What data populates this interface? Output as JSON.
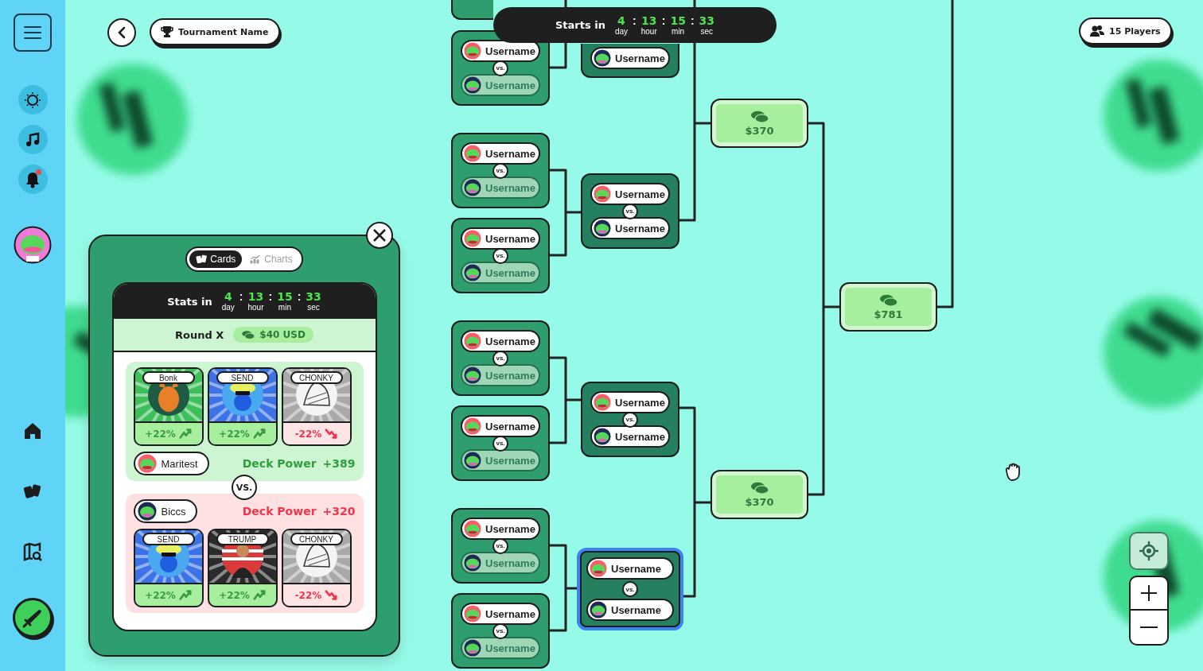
{
  "header": {
    "title": "Tournament Name",
    "players": "15 Players"
  },
  "countdown": {
    "label": "Starts in",
    "separator": ":",
    "units": [
      {
        "value": "4",
        "unit": "day"
      },
      {
        "value": "13",
        "unit": "hour"
      },
      {
        "value": "15",
        "unit": "min"
      },
      {
        "value": "33",
        "unit": "sec"
      }
    ]
  },
  "bracket": {
    "round_1": [
      {
        "selected": false,
        "vs": "vs.",
        "players": [
          {
            "name": "Username",
            "eliminated": false
          },
          {
            "name": "Username",
            "eliminated": true
          }
        ]
      },
      {
        "selected": false,
        "vs": "vs.",
        "players": [
          {
            "name": "Username",
            "eliminated": false
          },
          {
            "name": "Username",
            "eliminated": true
          }
        ]
      },
      {
        "selected": false,
        "vs": "vs.",
        "players": [
          {
            "name": "Username",
            "eliminated": false
          },
          {
            "name": "Username",
            "eliminated": true
          }
        ]
      },
      {
        "selected": false,
        "vs": "vs.",
        "players": [
          {
            "name": "Username",
            "eliminated": false
          },
          {
            "name": "Username",
            "eliminated": true
          }
        ]
      },
      {
        "selected": false,
        "vs": "vs.",
        "players": [
          {
            "name": "Username",
            "eliminated": false
          },
          {
            "name": "Username",
            "eliminated": true
          }
        ]
      },
      {
        "selected": false,
        "vs": "vs.",
        "players": [
          {
            "name": "Username",
            "eliminated": false
          },
          {
            "name": "Username",
            "eliminated": true
          }
        ]
      },
      {
        "selected": false,
        "vs": "vs.",
        "players": [
          {
            "name": "Username",
            "eliminated": false
          },
          {
            "name": "Username",
            "eliminated": true
          }
        ]
      }
    ],
    "round_2": [
      {
        "selected": false,
        "players": [
          {
            "name": "Username",
            "eliminated": false
          }
        ]
      },
      {
        "selected": false,
        "vs": "vs.",
        "players": [
          {
            "name": "Username",
            "eliminated": false
          },
          {
            "name": "Username",
            "eliminated": false
          }
        ]
      },
      {
        "selected": false,
        "vs": "vs.",
        "players": [
          {
            "name": "Username",
            "eliminated": false
          },
          {
            "name": "Username",
            "eliminated": false
          }
        ]
      },
      {
        "selected": true,
        "vs": "vs.",
        "players": [
          {
            "name": "Username",
            "eliminated": false
          },
          {
            "name": "Username",
            "eliminated": false
          }
        ]
      }
    ],
    "prizes": [
      {
        "amount": "$370"
      },
      {
        "amount": "$370"
      },
      {
        "amount": "$781"
      }
    ]
  },
  "match_panel": {
    "tabs": [
      {
        "label": "Cards",
        "selected": true
      },
      {
        "label": "Charts",
        "selected": false
      }
    ],
    "stats": {
      "label": "Stats in",
      "separator": ":",
      "units": [
        {
          "value": "4",
          "unit": "day"
        },
        {
          "value": "13",
          "unit": "hour"
        },
        {
          "value": "15",
          "unit": "min"
        },
        {
          "value": "33",
          "unit": "sec"
        }
      ]
    },
    "round": {
      "label": "Round X",
      "prize": "$40 USD"
    },
    "vs": "VS.",
    "teams": [
      {
        "player": "Maritest",
        "power_label": "Deck Power",
        "power": "+389",
        "leading": true,
        "cards": [
          {
            "name": "Bonk",
            "change": "+22%",
            "rising": true,
            "color": "#3fbf5c"
          },
          {
            "name": "SEND",
            "change": "+22%",
            "rising": true,
            "color": "#3b72e6"
          },
          {
            "name": "CHONKY",
            "change": "-22%",
            "rising": false,
            "color": "#a9a9a9"
          }
        ]
      },
      {
        "player": "Biccs",
        "power_label": "Deck Power",
        "power": "+320",
        "leading": false,
        "cards": [
          {
            "name": "SEND",
            "change": "+22%",
            "rising": true,
            "color": "#3b72e6"
          },
          {
            "name": "TRUMP",
            "change": "+22%",
            "rising": true,
            "color": "#2b2b2b"
          },
          {
            "name": "CHONKY",
            "change": "-22%",
            "rising": false,
            "color": "#a9a9a9"
          }
        ]
      }
    ]
  }
}
